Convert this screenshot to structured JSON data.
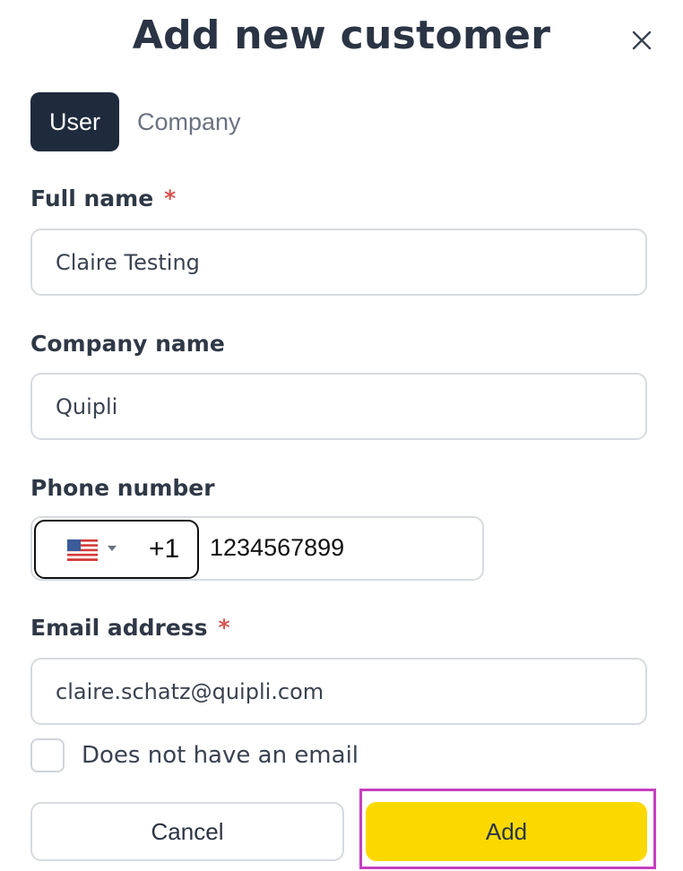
{
  "dialog": {
    "title": "Add new customer",
    "close_icon": "close-icon"
  },
  "tabs": [
    {
      "label": "User",
      "selected": true
    },
    {
      "label": "Company",
      "selected": false
    }
  ],
  "form": {
    "full_name": {
      "label": "Full name",
      "required_mark": "*",
      "value": "Claire Testing"
    },
    "company_name": {
      "label": "Company name",
      "value": "Quipli"
    },
    "phone": {
      "label": "Phone number",
      "country_flag_icon": "us-flag-icon",
      "dial_code": "+1",
      "value": "1234567899"
    },
    "email": {
      "label": "Email address",
      "required_mark": "*",
      "value": "claire.schatz@quipli.com"
    },
    "no_email": {
      "label": "Does not have an email",
      "checked": false
    }
  },
  "actions": {
    "cancel_label": "Cancel",
    "add_label": "Add"
  },
  "colors": {
    "primary_dark": "#1f2b3d",
    "accent_yellow": "#fbd900",
    "required_red": "#d9534f",
    "highlight_magenta": "#c63fc0"
  }
}
